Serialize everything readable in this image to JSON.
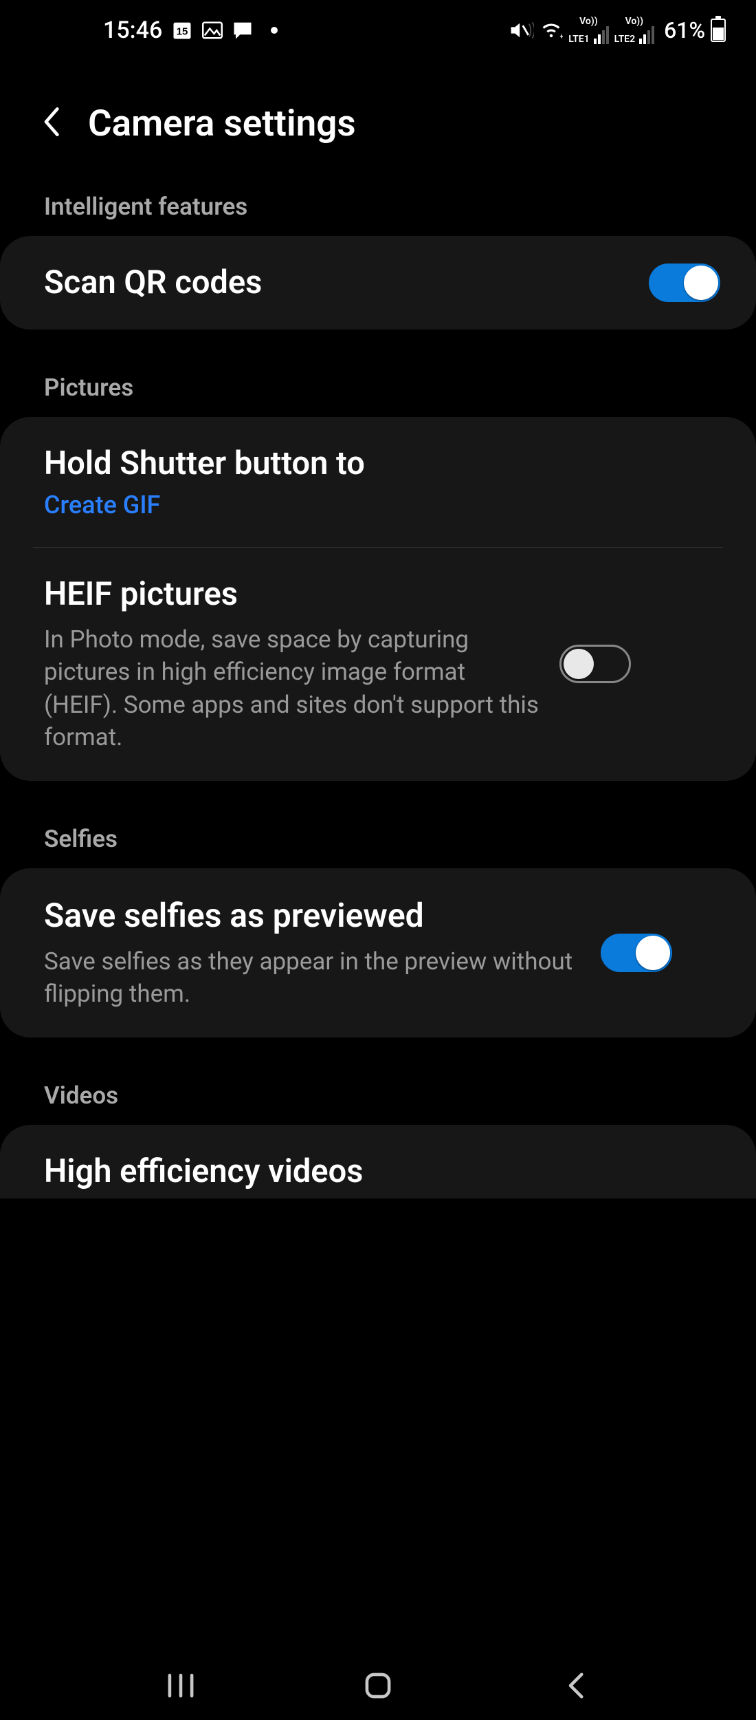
{
  "status_bar": {
    "time": "15:46",
    "calendar_day": "15",
    "sim1_label": "LTE1",
    "sim2_label": "LTE2",
    "vo_label": "Vo))",
    "battery_text": "61%"
  },
  "header": {
    "title": "Camera settings"
  },
  "sections": {
    "intelligent": {
      "label": "Intelligent features"
    },
    "pictures": {
      "label": "Pictures"
    },
    "selfies": {
      "label": "Selfies"
    },
    "videos": {
      "label": "Videos"
    }
  },
  "items": {
    "scan_qr": {
      "title": "Scan QR codes",
      "toggle": true
    },
    "hold_shutter": {
      "title": "Hold Shutter button to",
      "value": "Create GIF"
    },
    "heif": {
      "title": "HEIF pictures",
      "desc": "In Photo mode, save space by capturing pictures in high efficiency image format (HEIF). Some apps and sites don't support this format.",
      "toggle": false
    },
    "selfie_preview": {
      "title": "Save selfies as previewed",
      "desc": "Save selfies as they appear in the preview without flipping them.",
      "toggle": true
    },
    "hev": {
      "title": "High efficiency videos"
    }
  }
}
